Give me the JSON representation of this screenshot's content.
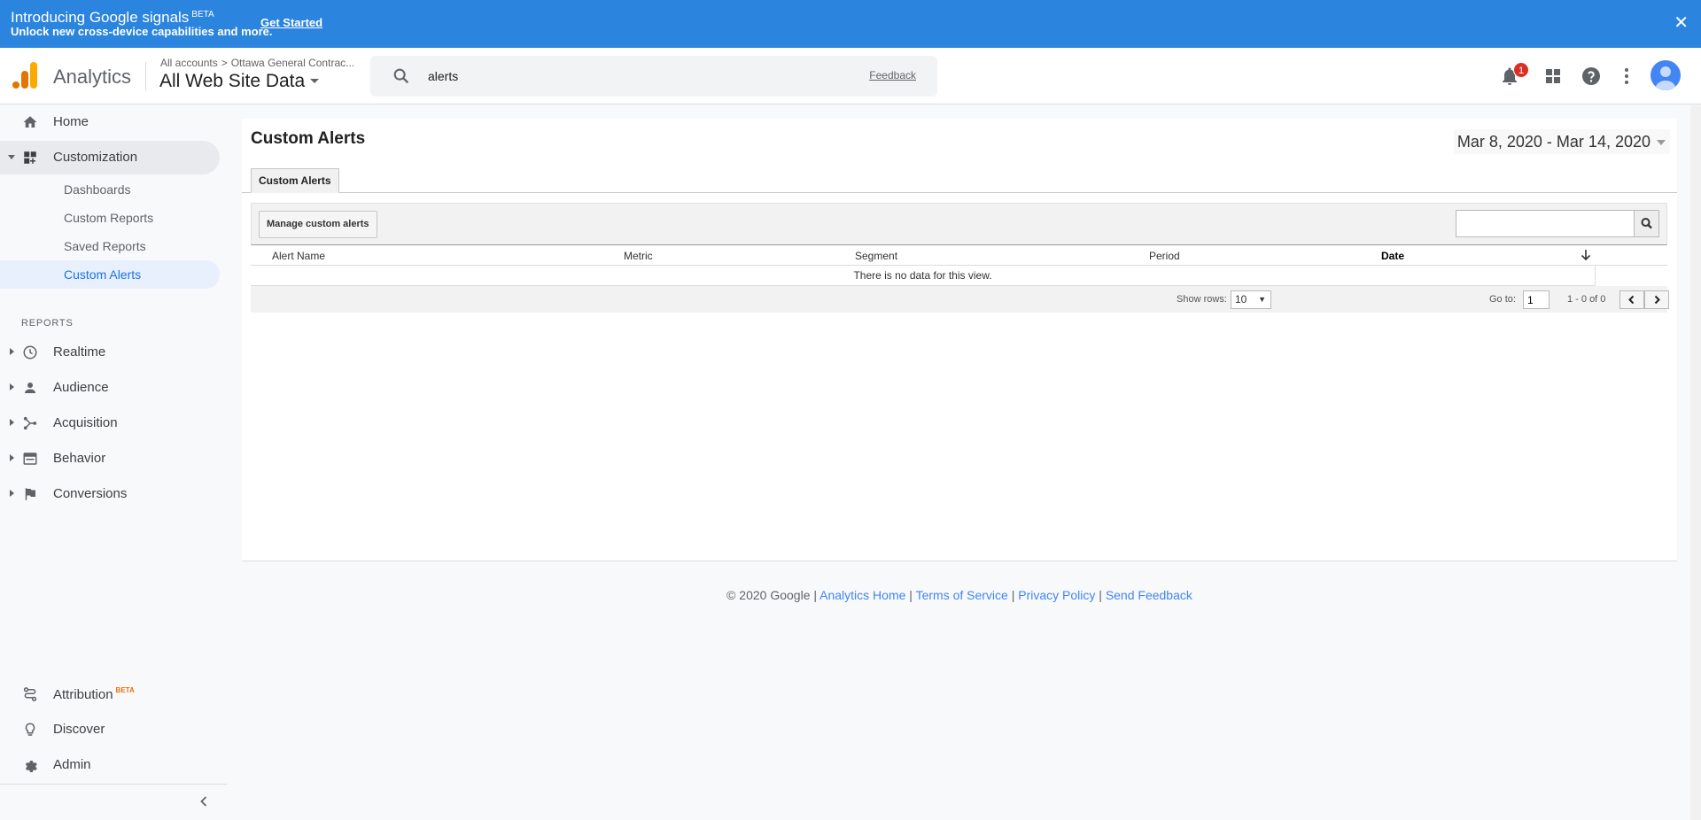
{
  "banner": {
    "title": "Introducing Google signals",
    "title_badge": "BETA",
    "subtitle": "Unlock new cross-device capabilities and more.",
    "cta": "Get Started",
    "close": "✕"
  },
  "header": {
    "brand": "Analytics",
    "breadcrumb": {
      "root": "All accounts",
      "account": "Ottawa General Contrac..."
    },
    "view": "All Web Site Data",
    "search_value": "alerts",
    "search_feedback": "Feedback",
    "notification_count": "1",
    "icons": [
      "bell-icon",
      "apps-grid-icon",
      "help-icon",
      "more-vert-icon",
      "avatar"
    ]
  },
  "sidebar": {
    "home": "Home",
    "customization": "Customization",
    "sub_items": [
      "Dashboards",
      "Custom Reports",
      "Saved Reports",
      "Custom Alerts"
    ],
    "reports_heading": "REPORTS",
    "reports": [
      "Realtime",
      "Audience",
      "Acquisition",
      "Behavior",
      "Conversions"
    ],
    "attribution": "Attribution",
    "attribution_badge": "BETA",
    "discover": "Discover",
    "admin": "Admin"
  },
  "main": {
    "title": "Custom Alerts",
    "date_range": "Mar 8, 2020 - Mar 14, 2020",
    "tab": "Custom Alerts",
    "manage_button": "Manage custom alerts",
    "columns": [
      "Alert Name",
      "Metric",
      "Segment",
      "Period",
      "Date"
    ],
    "sorted_column": "Date",
    "empty_message": "There is no data for this view.",
    "show_rows_label": "Show rows:",
    "show_rows_value": "10",
    "goto_label": "Go to:",
    "goto_value": "1",
    "range_text": "1 - 0 of 0"
  },
  "footer": {
    "copyright": "© 2020 Google",
    "sep": "|",
    "links": [
      "Analytics Home",
      "Terms of Service",
      "Privacy Policy",
      "Send Feedback"
    ]
  },
  "colors": {
    "banner": "#2b84de",
    "accent": "#1a73e8",
    "logo_dark": "#e37400",
    "logo_light": "#f9ab00",
    "badge": "#d93025"
  }
}
